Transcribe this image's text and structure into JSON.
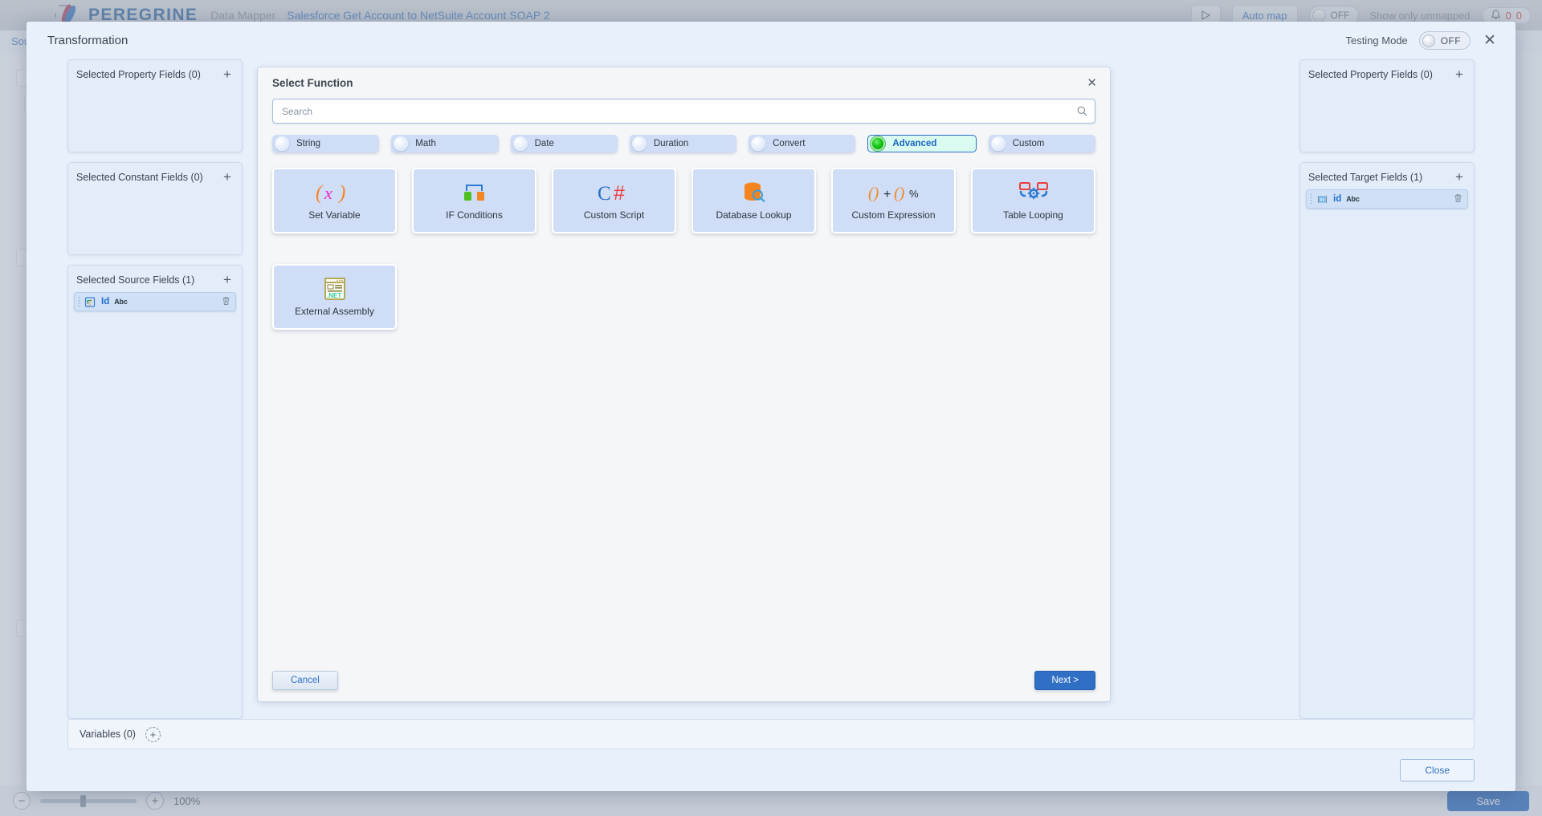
{
  "app": {
    "brand": "PEREGRINE",
    "product": "Data Mapper",
    "breadcrumb": "Salesforce Get Account to NetSuite Account SOAP 2",
    "play_icon": "play-icon",
    "auto_map_label": "Auto map",
    "unmapped_toggle_state": "OFF",
    "unmapped_label": "Show only unmapped",
    "bell_icon": "bell-icon",
    "badge_one": "0",
    "badge_two": "0",
    "source_label": "Sour",
    "zoom_level": "100%",
    "save_label": "Save",
    "minus_label": "−",
    "plus_label": "+"
  },
  "modal": {
    "title": "Transformation",
    "testing_mode_label": "Testing Mode",
    "testing_mode_state": "OFF",
    "close_icon": "close-icon",
    "variables_label": "Variables (0)",
    "variables_add_icon": "plus-circle-icon",
    "close_button_label": "Close"
  },
  "left_panels": [
    {
      "title": "Selected Property Fields (0)",
      "add_icon": "plus-icon",
      "fields": []
    },
    {
      "title": "Selected Constant Fields (0)",
      "add_icon": "plus-icon",
      "fields": []
    },
    {
      "title": "Selected Source Fields (1)",
      "add_icon": "plus-icon",
      "fields": [
        {
          "name": "Id",
          "type": "Abc",
          "icon": "source-field-icon",
          "delete_icon": "trash-icon"
        }
      ]
    }
  ],
  "right_panels": [
    {
      "title": "Selected Property Fields (0)",
      "add_icon": "plus-icon",
      "fields": []
    },
    {
      "title": "Selected Target Fields (1)",
      "add_icon": "plus-icon",
      "fields": [
        {
          "name": "id",
          "type": "Abc",
          "icon": "target-field-icon",
          "delete_icon": "trash-icon"
        }
      ]
    }
  ],
  "select_function": {
    "title": "Select Function",
    "close_icon": "close-icon",
    "search_placeholder": "Search",
    "search_value": "",
    "search_icon": "search-icon",
    "categories": [
      {
        "label": "String",
        "selected": false
      },
      {
        "label": "Math",
        "selected": false
      },
      {
        "label": "Date",
        "selected": false
      },
      {
        "label": "Duration",
        "selected": false
      },
      {
        "label": "Convert",
        "selected": false
      },
      {
        "label": "Advanced",
        "selected": true
      },
      {
        "label": "Custom",
        "selected": false
      }
    ],
    "functions": [
      {
        "label": "Set Variable",
        "icon": "set-variable-icon"
      },
      {
        "label": "IF Conditions",
        "icon": "if-conditions-icon"
      },
      {
        "label": "Custom Script",
        "icon": "csharp-icon"
      },
      {
        "label": "Database Lookup",
        "icon": "database-lookup-icon"
      },
      {
        "label": "Custom Expression",
        "icon": "custom-expression-icon"
      },
      {
        "label": "Table Looping",
        "icon": "table-looping-icon"
      },
      {
        "label": "External Assembly",
        "icon": "dotnet-assembly-icon"
      }
    ],
    "cancel_label": "Cancel",
    "next_label": "Next >"
  },
  "colors": {
    "accent_blue": "#2f6fc4",
    "panel_blue": "#e3ecf9",
    "chip_blue": "#cfddf6",
    "selected_green": "#16c616",
    "selected_bg": "#d9fbf0",
    "modal_bg": "#e8f0fb"
  }
}
